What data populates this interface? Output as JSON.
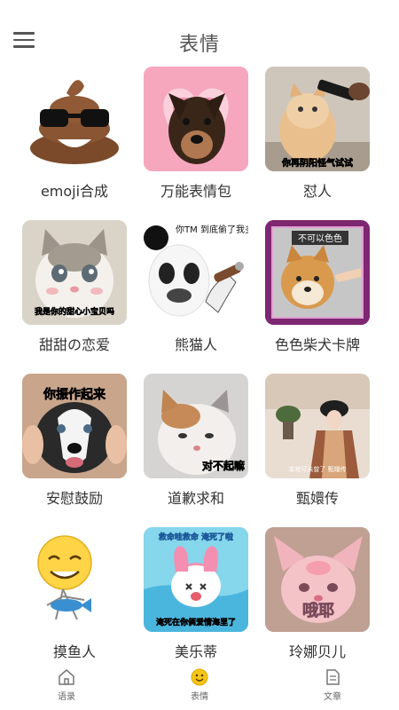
{
  "header": {
    "title": "表情"
  },
  "grid": {
    "items": [
      {
        "label": "emoji合成",
        "icon": "poop-sunglasses-emoji"
      },
      {
        "label": "万能表情包",
        "icon": "dog-heart-image"
      },
      {
        "label": "怼人",
        "icon": "cat-gun-image",
        "caption": "你再阴阳怪气试试"
      },
      {
        "label": "甜甜の恋爱",
        "icon": "kitten-image",
        "caption": "我是你的甜心小宝贝吗"
      },
      {
        "label": "熊猫人",
        "icon": "panda-meme-image",
        "caption": "你TM 到底偷了我多少图"
      },
      {
        "label": "色色柴犬卡牌",
        "icon": "shiba-card-image",
        "caption": "不可以色色"
      },
      {
        "label": "安慰鼓励",
        "icon": "husky-image",
        "caption": "你振作起来"
      },
      {
        "label": "道歉求和",
        "icon": "sorry-cat-image",
        "caption": "对不起嘛"
      },
      {
        "label": "甄嬛传",
        "icon": "drama-image",
        "caption": "本宫可未曾了  甄嬛传"
      },
      {
        "label": "摸鱼人",
        "icon": "smiley-fish-image"
      },
      {
        "label": "美乐蒂",
        "icon": "melody-image",
        "caption_top": "救命哇救命 淹死了啦",
        "caption": "淹死在你俩爱情海里了"
      },
      {
        "label": "玲娜贝儿",
        "icon": "linabell-image",
        "caption": "哦耶"
      }
    ]
  },
  "tabbar": {
    "tabs": [
      {
        "label": "语录",
        "icon": "home-icon"
      },
      {
        "label": "表情",
        "icon": "smiley-icon",
        "color": "#e8b820"
      },
      {
        "label": "文章",
        "icon": "document-icon"
      }
    ]
  }
}
